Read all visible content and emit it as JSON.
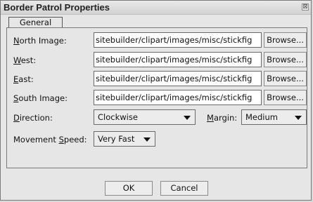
{
  "window": {
    "title": "Border Patrol Properties",
    "close_glyph": "⊠"
  },
  "tabs": [
    {
      "label": "General"
    }
  ],
  "fields": {
    "north": {
      "label_prefix": "",
      "label_underline": "N",
      "label_suffix": "orth Image:",
      "value": "sitebuilder/clipart/images/misc/stickfig"
    },
    "west": {
      "label_prefix": "",
      "label_underline": "W",
      "label_suffix": "est:",
      "value": "sitebuilder/clipart/images/misc/stickfig"
    },
    "east": {
      "label_prefix": "",
      "label_underline": "E",
      "label_suffix": "ast:",
      "value": "sitebuilder/clipart/images/misc/stickfig"
    },
    "south": {
      "label_prefix": "",
      "label_underline": "S",
      "label_suffix": "outh Image:",
      "value": "sitebuilder/clipart/images/misc/stickfig"
    }
  },
  "browse_label": "Browse...",
  "direction": {
    "label_prefix": "",
    "label_underline": "D",
    "label_suffix": "irection:",
    "value": "Clockwise"
  },
  "margin": {
    "label_prefix": "",
    "label_underline": "M",
    "label_suffix": "argin:",
    "value": "Medium"
  },
  "speed": {
    "label_prefix": "Movement ",
    "label_underline": "S",
    "label_suffix": "peed:",
    "value": "Very Fast"
  },
  "buttons": {
    "ok": "OK",
    "cancel": "Cancel"
  }
}
